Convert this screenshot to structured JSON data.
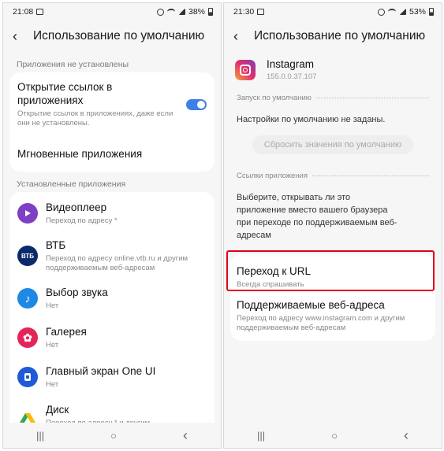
{
  "left": {
    "status": {
      "time": "21:08",
      "battery": "38%"
    },
    "title": "Использование по умолчанию",
    "section_not_installed": "Приложения не установлены",
    "open_links": {
      "title": "Открытие ссылок в приложениях",
      "subtitle": "Открытие ссылок в приложениях, даже если они не установлены."
    },
    "instant_apps": "Мгновенные приложения",
    "section_installed": "Установленные приложения",
    "apps": [
      {
        "name": "Видеоплеер",
        "sub": "Переход по адресу *",
        "icon": "video-player-icon",
        "color": "#7d3fc4"
      },
      {
        "name": "ВТБ",
        "sub": "Переход по адресу online.vtb.ru и другим поддерживаемым веб-адресам",
        "icon": "vtb-icon",
        "color": "#0b2a6b",
        "glyph": "ВТБ"
      },
      {
        "name": "Выбор звука",
        "sub": "Нет",
        "icon": "music-note-icon",
        "color": "#1e88e5"
      },
      {
        "name": "Галерея",
        "sub": "Нет",
        "icon": "gallery-flower-icon",
        "color": "#e5245a"
      },
      {
        "name": "Главный экран One UI",
        "sub": "Нет",
        "icon": "home-screen-icon",
        "color": "#1e5bd6"
      },
      {
        "name": "Диск",
        "sub": "Переход по адресу * и другим поддерживаемым веб-адресам",
        "icon": "google-drive-icon",
        "color": "#ffffff"
      }
    ]
  },
  "right": {
    "status": {
      "time": "21:30",
      "battery": "53%"
    },
    "title": "Использование по умолчанию",
    "app": {
      "name": "Instagram",
      "version": "155.0.0.37.107"
    },
    "launch_default_header": "Запуск по умолчанию",
    "no_defaults_text": "Настройки по умолчанию не заданы.",
    "reset_button": "Сбросить значения по умолчанию",
    "app_links_header": "Ссылки приложения",
    "app_links_desc": "Выберите, открывать ли это приложение вместо вашего браузера при переходе по поддерживаемым веб-адресам",
    "go_to_url": {
      "title": "Переход к URL",
      "subtitle": "Всегда спрашивать"
    },
    "supported_urls": {
      "title": "Поддерживаемые веб-адреса",
      "subtitle": "Переход по адресу www.instagram.com и другим поддерживаемым веб-адресам"
    }
  },
  "nav": {
    "recents": "|||",
    "home": "○",
    "back": "‹"
  },
  "colors": {
    "accent": "#3d80e6",
    "highlight": "#e0001b"
  }
}
